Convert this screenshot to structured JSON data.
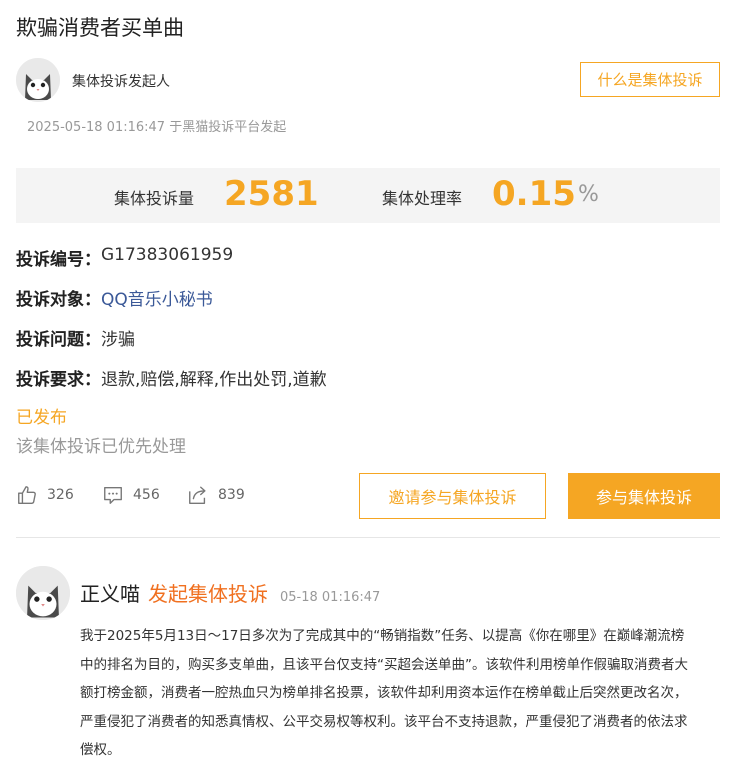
{
  "page": {
    "title": "欺骗消费者买单曲"
  },
  "initiator": {
    "label": "集体投诉发起人",
    "what_is_button": "什么是集体投诉",
    "meta": "2025-05-18 01:16:47 于黑猫投诉平台发起"
  },
  "stats": {
    "count_label": "集体投诉量",
    "count_value": "2581",
    "rate_label": "集体处理率",
    "rate_value": "0.15",
    "rate_unit": "%"
  },
  "details": [
    {
      "key": "投诉编号：",
      "value": "G17383061959"
    },
    {
      "key": "投诉对象：",
      "value": "QQ音乐小秘书"
    },
    {
      "key": "投诉问题：",
      "value": "涉骗"
    },
    {
      "key": "投诉要求：",
      "value": "退款,赔偿,解释,作出处罚,道歉"
    }
  ],
  "status": {
    "published": "已发布",
    "priority": "该集体投诉已优先处理"
  },
  "actions": {
    "likes": "326",
    "comments": "456",
    "shares": "839",
    "invite_button": "邀请参与集体投诉",
    "join_button": "参与集体投诉"
  },
  "comment": {
    "user": "正义喵",
    "action": "发起集体投诉",
    "time": "05-18 01:16:47",
    "body": "我于2025年5月13日～17日多次为了完成其中的“畅销指数”任务、以提高《你在哪里》在巅峰潮流榜中的排名为目的，购买多支单曲，且该平台仅支持“买超会送单曲”。该软件利用榜单作假骗取消费者大额打榜金额，消费者一腔热血只为榜单排名投票，该软件却利用资本运作在榜单截止后突然更改名次，严重侵犯了消费者的知悉真情权、公平交易权等权利。该平台不支持退款，严重侵犯了消费者的依法求偿权。"
  },
  "colors": {
    "accent": "#f5a623",
    "action_orange": "#f07020",
    "link_blue": "#3b5998"
  }
}
